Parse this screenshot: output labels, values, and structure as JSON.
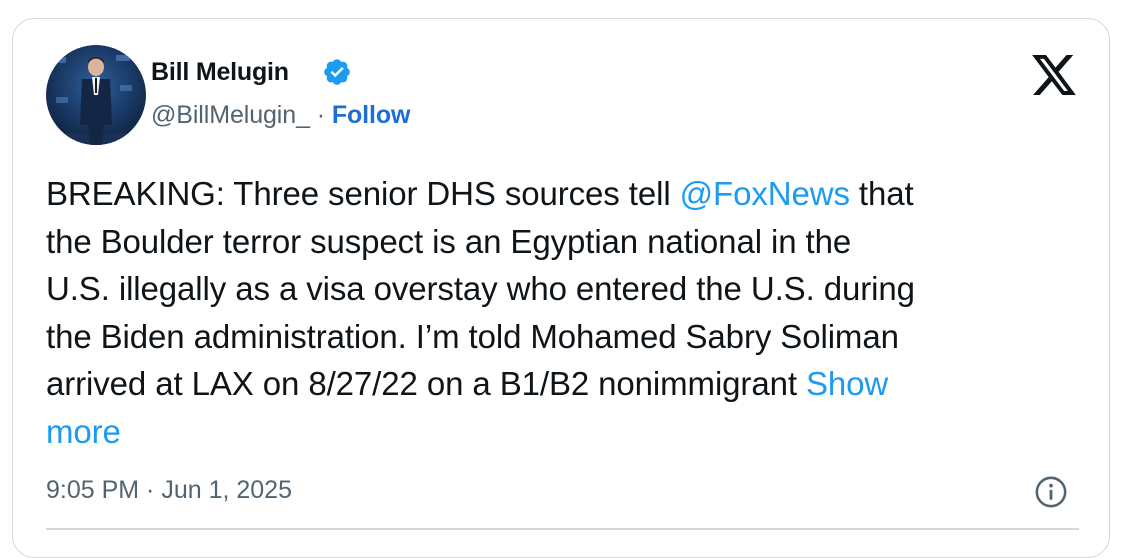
{
  "author": {
    "name": "Bill Melugin",
    "handle": "@BillMelugin_",
    "separator": "·",
    "follow_label": "Follow",
    "verified": true,
    "verified_color": "#1d9bf0"
  },
  "tweet": {
    "lines": [
      [
        {
          "text": "BREAKING: Three senior DHS sources tell "
        },
        {
          "text": "@FoxNews",
          "link": true
        },
        {
          "text": " that"
        }
      ],
      [
        {
          "text": "the Boulder terror suspect is an Egyptian national in the"
        }
      ],
      [
        {
          "text": "U.S. illegally as a visa overstay who entered the U.S. during"
        }
      ],
      [
        {
          "text": "the Biden administration. I’m told Mohamed Sabry Soliman"
        }
      ],
      [
        {
          "text": "arrived at LAX on 8/27/22 on a B1/B2 nonimmigrant "
        },
        {
          "text": "Show",
          "link": true
        }
      ],
      [
        {
          "text": "more",
          "link": true
        }
      ]
    ]
  },
  "footer": {
    "timestamp": "9:05 PM · Jun 1, 2025"
  },
  "icons": {
    "logo": "x-logo-icon",
    "info": "info-icon",
    "verified": "verified-badge-icon"
  },
  "colors": {
    "text": "#0f1419",
    "secondary": "#536471",
    "link": "#1d9bf0",
    "follow": "#1d6fd1",
    "border": "#cfd9de"
  }
}
